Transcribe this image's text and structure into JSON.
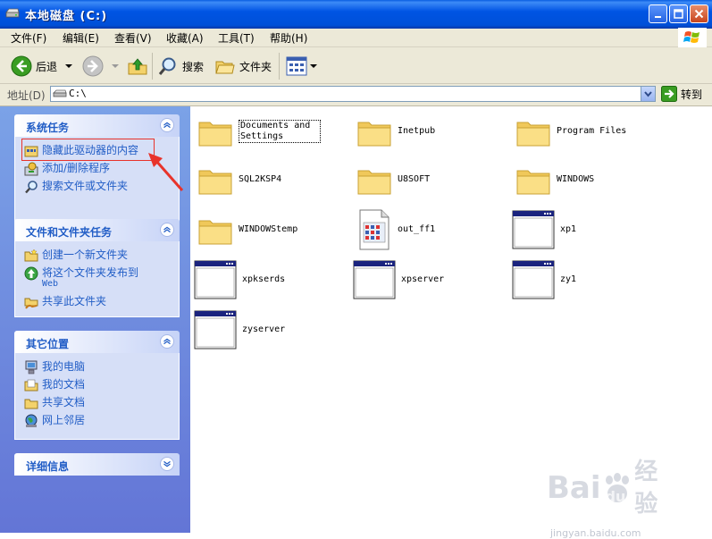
{
  "window": {
    "title": "本地磁盘 (C:)"
  },
  "menu": [
    "文件(F)",
    "编辑(E)",
    "查看(V)",
    "收藏(A)",
    "工具(T)",
    "帮助(H)"
  ],
  "toolbar": {
    "back": "后退",
    "search": "搜索",
    "folders": "文件夹"
  },
  "address": {
    "label": "地址(D)",
    "value": "C:\\",
    "go": "转到"
  },
  "panels": {
    "system_tasks": {
      "title": "系统任务",
      "items": [
        "隐藏此驱动器的内容",
        "添加/删除程序",
        "搜索文件或文件夹"
      ]
    },
    "file_tasks": {
      "title": "文件和文件夹任务",
      "items": [
        "创建一个新文件夹",
        "将这个文件夹发布到",
        "Web",
        "共享此文件夹"
      ]
    },
    "other_places": {
      "title": "其它位置",
      "items": [
        "我的电脑",
        "我的文档",
        "共享文档",
        "网上邻居"
      ]
    },
    "details": {
      "title": "详细信息"
    }
  },
  "files": [
    {
      "name": "Documents and Settings",
      "type": "folder"
    },
    {
      "name": "Inetpub",
      "type": "folder"
    },
    {
      "name": "Program Files",
      "type": "folder"
    },
    {
      "name": "SQL2KSP4",
      "type": "folder"
    },
    {
      "name": "U8SOFT",
      "type": "folder"
    },
    {
      "name": "WINDOWS",
      "type": "folder"
    },
    {
      "name": "WINDOWStemp",
      "type": "folder"
    },
    {
      "name": "out_ff1",
      "type": "document"
    },
    {
      "name": "xp1",
      "type": "app"
    },
    {
      "name": "xpkserds",
      "type": "app"
    },
    {
      "name": "xpserver",
      "type": "app"
    },
    {
      "name": "zy1",
      "type": "app"
    },
    {
      "name": "zyserver",
      "type": "app"
    }
  ],
  "watermark": {
    "brand": "Bai",
    "paw": "du",
    "suffix": "经验",
    "url": "jingyan.baidu.com"
  },
  "colors": {
    "title_bar": "#0054e3",
    "task_link": "#215dc6",
    "highlight": "#e8332b",
    "left_pane": "#7ba2e7"
  }
}
